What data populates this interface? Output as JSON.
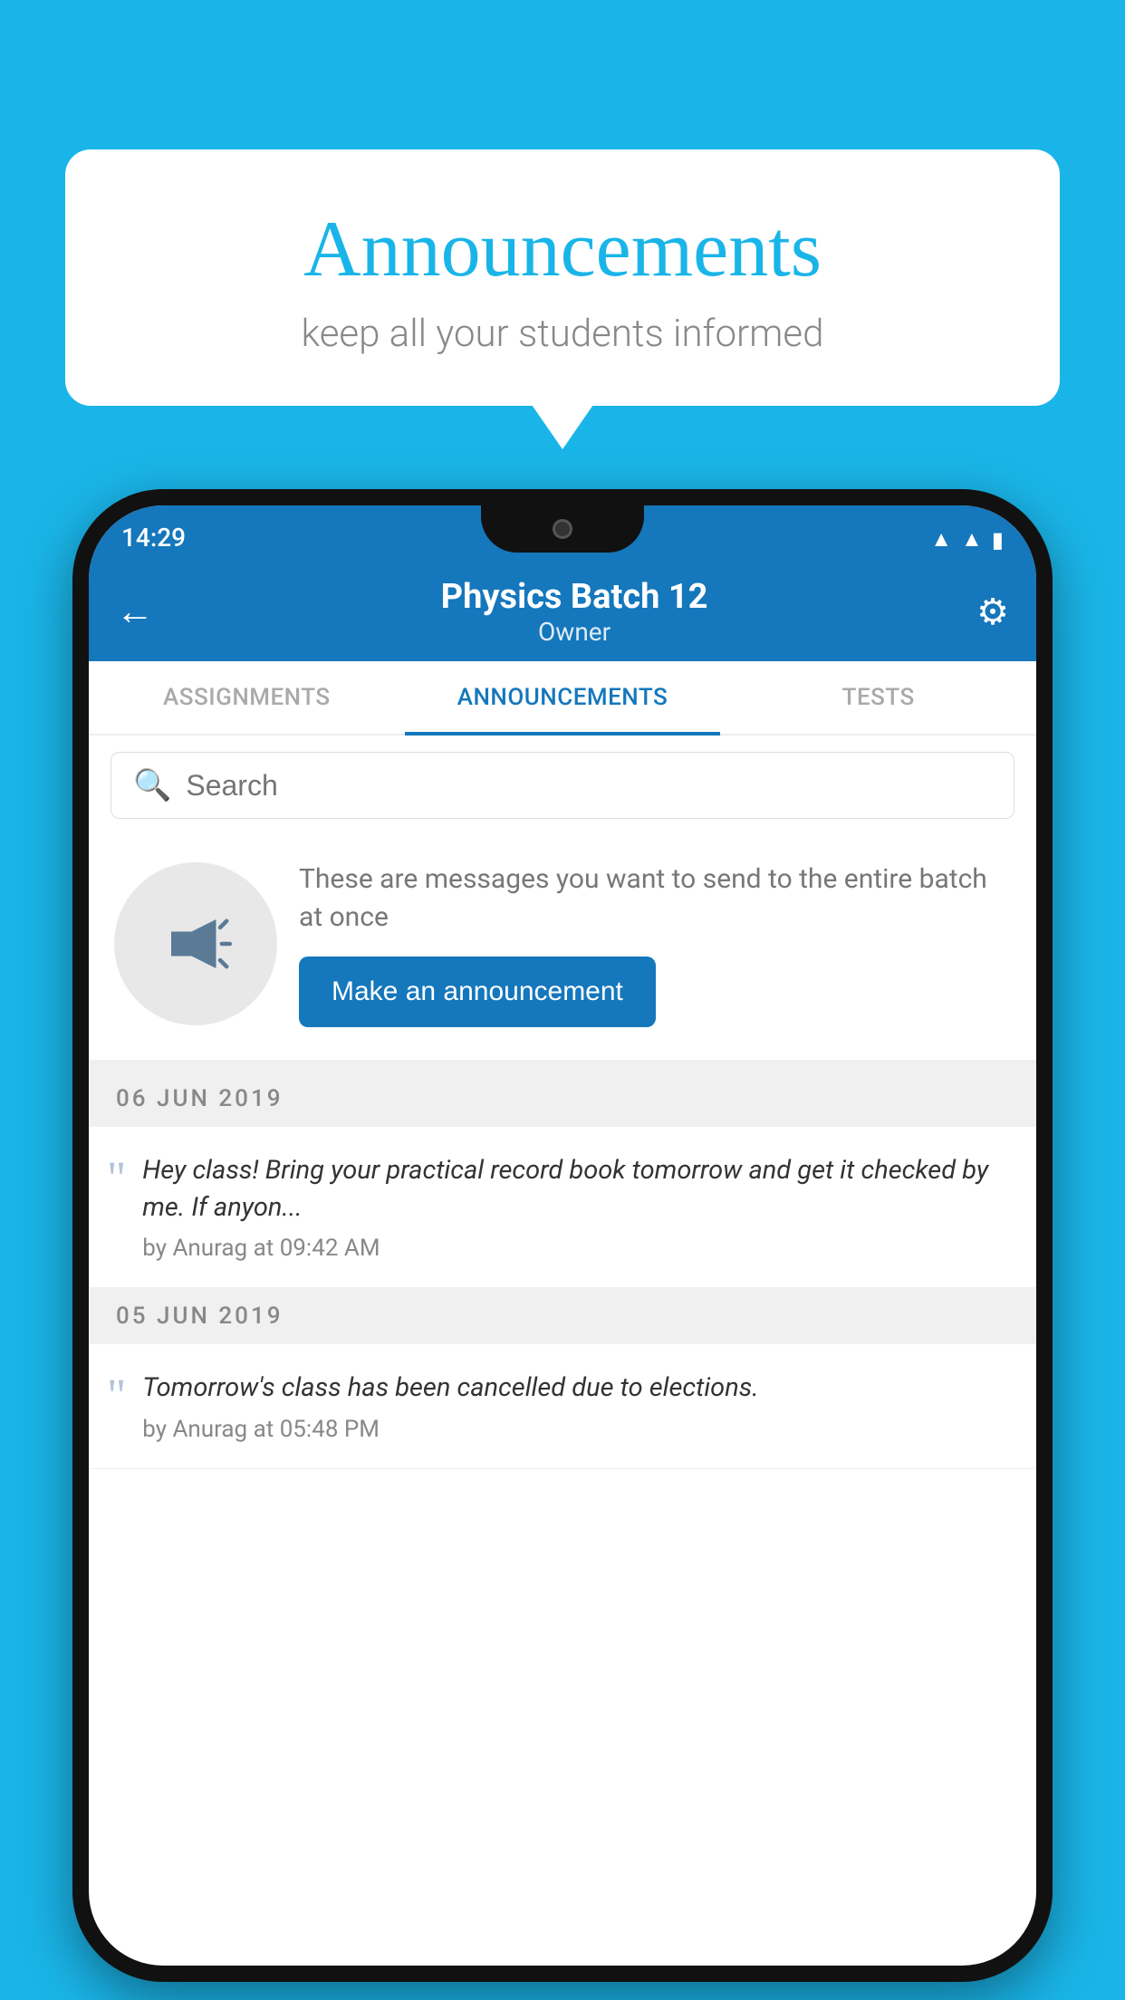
{
  "background_color": "#1ab5e8",
  "speech_bubble": {
    "title": "Announcements",
    "subtitle": "keep all your students informed"
  },
  "phone": {
    "status_bar": {
      "time": "14:29",
      "icons": [
        "wifi",
        "signal",
        "battery"
      ]
    },
    "app_bar": {
      "title": "Physics Batch 12",
      "subtitle": "Owner",
      "back_label": "←",
      "gear_label": "⚙"
    },
    "tabs": [
      {
        "label": "ASSIGNMENTS",
        "active": false
      },
      {
        "label": "ANNOUNCEMENTS",
        "active": true
      },
      {
        "label": "TESTS",
        "active": false
      },
      {
        "label": "...",
        "active": false
      }
    ],
    "search": {
      "placeholder": "Search"
    },
    "promo": {
      "text": "These are messages you want to send to the entire batch at once",
      "button_label": "Make an announcement"
    },
    "announcements": [
      {
        "date": "06  JUN  2019",
        "text": "Hey class! Bring your practical record book tomorrow and get it checked by me. If anyon...",
        "author": "by Anurag at 09:42 AM"
      },
      {
        "date": "05  JUN  2019",
        "text": "Tomorrow's class has been cancelled due to elections.",
        "author": "by Anurag at 05:48 PM"
      }
    ]
  }
}
